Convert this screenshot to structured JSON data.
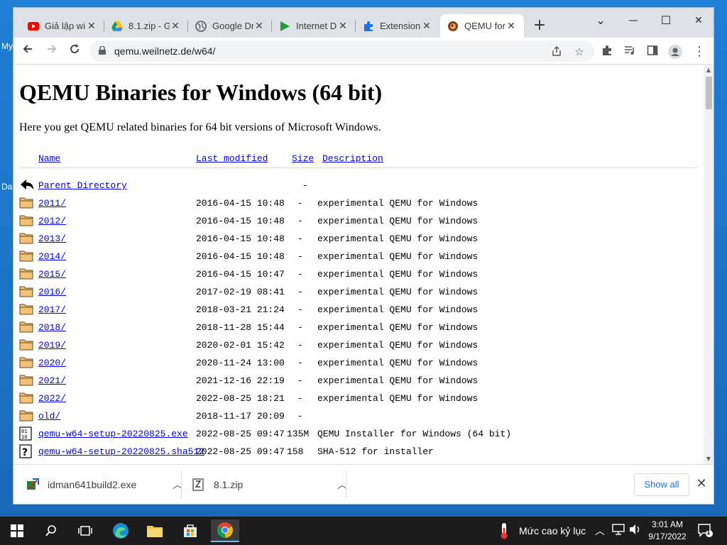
{
  "desktop": {
    "labels": [
      "My",
      "Da"
    ]
  },
  "tabs": [
    {
      "label": "Giả lập wi",
      "icon": "youtube-icon"
    },
    {
      "label": "8.1.zip - G",
      "icon": "google-drive-icon"
    },
    {
      "label": "Google Dr",
      "icon": "globe-icon"
    },
    {
      "label": "Internet D",
      "icon": "play-icon"
    },
    {
      "label": "Extension",
      "icon": "puzzle-icon"
    },
    {
      "label": "QEMU for",
      "icon": "qemu-icon",
      "active": true
    }
  ],
  "window_controls": {
    "minimize": "—",
    "maximize": "☐",
    "close": "✕",
    "tab_search": "⌄",
    "new_tab": "+"
  },
  "address_bar": {
    "url": "qemu.weilnetz.de/w64/"
  },
  "page": {
    "title": "QEMU Binaries for Windows (64 bit)",
    "intro": "Here you get QEMU related binaries for 64 bit versions of Microsoft Windows.",
    "columns": {
      "name": "Name",
      "last_modified": "Last modified",
      "size": "Size",
      "description": "Description"
    },
    "rows": [
      {
        "name": "Parent Directory",
        "date": "",
        "size": "-",
        "desc": "",
        "icon": "back-icon"
      },
      {
        "name": "2011/",
        "date": "2016-04-15 10:48",
        "size": "-",
        "desc": "experimental QEMU for Windows",
        "icon": "folder-icon"
      },
      {
        "name": "2012/",
        "date": "2016-04-15 10:48",
        "size": "-",
        "desc": "experimental QEMU for Windows",
        "icon": "folder-icon"
      },
      {
        "name": "2013/",
        "date": "2016-04-15 10:48",
        "size": "-",
        "desc": "experimental QEMU for Windows",
        "icon": "folder-icon"
      },
      {
        "name": "2014/",
        "date": "2016-04-15 10:48",
        "size": "-",
        "desc": "experimental QEMU for Windows",
        "icon": "folder-icon"
      },
      {
        "name": "2015/",
        "date": "2016-04-15 10:47",
        "size": "-",
        "desc": "experimental QEMU for Windows",
        "icon": "folder-icon"
      },
      {
        "name": "2016/",
        "date": "2017-02-19 08:41",
        "size": "-",
        "desc": "experimental QEMU for Windows",
        "icon": "folder-icon"
      },
      {
        "name": "2017/",
        "date": "2018-03-21 21:24",
        "size": "-",
        "desc": "experimental QEMU for Windows",
        "icon": "folder-icon"
      },
      {
        "name": "2018/",
        "date": "2018-11-28 15:44",
        "size": "-",
        "desc": "experimental QEMU for Windows",
        "icon": "folder-icon"
      },
      {
        "name": "2019/",
        "date": "2020-02-01 15:42",
        "size": "-",
        "desc": "experimental QEMU for Windows",
        "icon": "folder-icon"
      },
      {
        "name": "2020/",
        "date": "2020-11-24 13:00",
        "size": "-",
        "desc": "experimental QEMU for Windows",
        "icon": "folder-icon"
      },
      {
        "name": "2021/",
        "date": "2021-12-16 22:19",
        "size": "-",
        "desc": "experimental QEMU for Windows",
        "icon": "folder-icon"
      },
      {
        "name": "2022/",
        "date": "2022-08-25 18:21",
        "size": "-",
        "desc": "experimental QEMU for Windows",
        "icon": "folder-icon"
      },
      {
        "name": "old/",
        "date": "2018-11-17 20:09",
        "size": "-",
        "desc": "",
        "icon": "folder-icon"
      },
      {
        "name": "qemu-w64-setup-20220825.exe",
        "date": "2022-08-25 09:47",
        "size": "135M",
        "desc": "QEMU Installer for Windows (64 bit)",
        "icon": "binary-file-icon"
      },
      {
        "name": "qemu-w64-setup-20220825.sha512",
        "date": "2022-08-25 09:47",
        "size": "158",
        "desc": "SHA-512 for installer",
        "icon": "unknown-file-icon"
      }
    ]
  },
  "downloads": {
    "items": [
      {
        "name": "idman641build2.exe",
        "icon": "idm-installer-icon"
      },
      {
        "name": "8.1.zip",
        "icon": "zip-file-icon"
      }
    ],
    "show_all": "Show all"
  },
  "taskbar": {
    "weather_text": "Mức cao kỷ lục",
    "time": "3:01 AM",
    "date": "9/17/2022",
    "notification_count": "1"
  }
}
